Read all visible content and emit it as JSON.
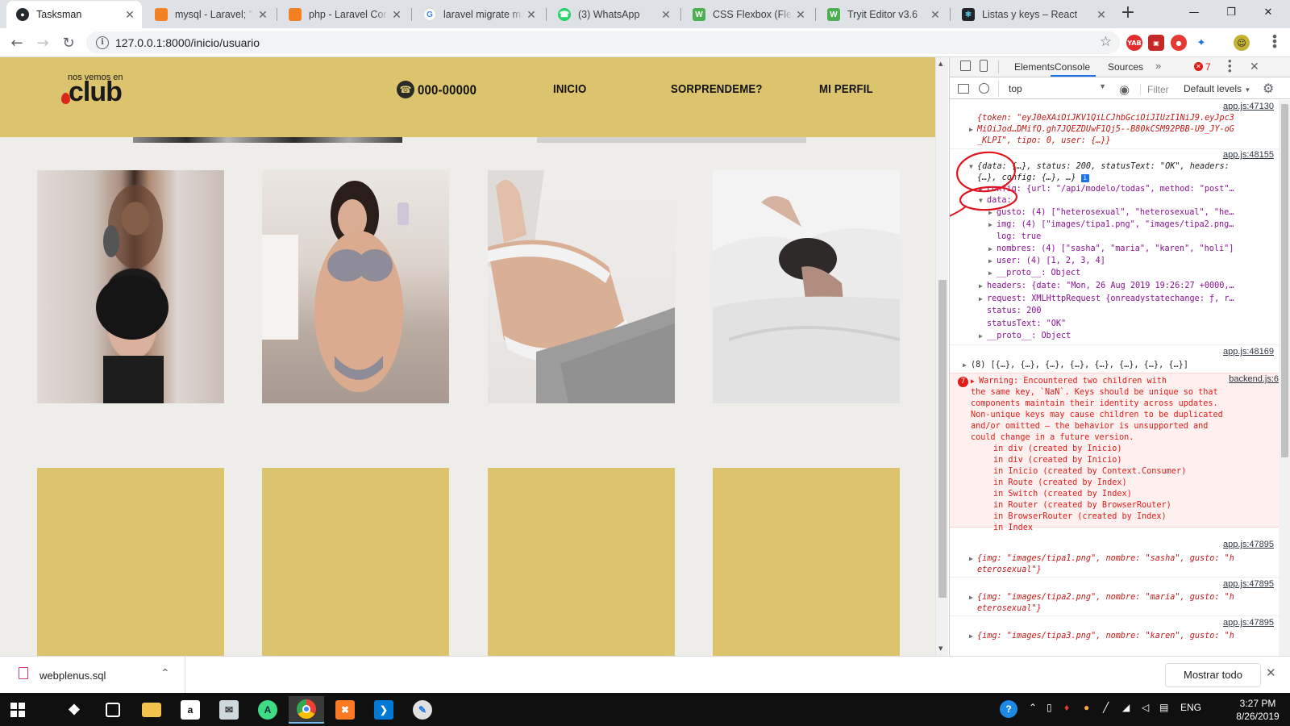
{
  "browser": {
    "tabs": [
      {
        "title": "Tasksman",
        "icon": "github-icon",
        "active": true
      },
      {
        "title": "mysql - Laravel; \"SQ",
        "icon": "stackoverflow-icon",
        "active": false
      },
      {
        "title": "php - Laravel Conne",
        "icon": "stackoverflow-icon",
        "active": false
      },
      {
        "title": "laravel migrate mac",
        "icon": "google-icon",
        "active": false
      },
      {
        "title": "(3) WhatsApp",
        "icon": "whatsapp-icon",
        "active": false
      },
      {
        "title": "CSS Flexbox (Flexibl",
        "icon": "w3schools-icon",
        "active": false
      },
      {
        "title": "Tryit Editor v3.6",
        "icon": "w3schools-icon",
        "active": false
      },
      {
        "title": "Listas y keys – React",
        "icon": "react-icon",
        "active": false
      }
    ],
    "url": "127.0.0.1:8000/inicio/usuario",
    "extensions": [
      "YAB",
      "",
      "",
      "",
      ""
    ]
  },
  "site": {
    "logo_small": "nos vemos en",
    "logo_big": "club",
    "phone": "000-00000",
    "nav": [
      "INICIO",
      "SORPRENDEME?",
      "MI PERFIL"
    ],
    "photos": [
      {
        "name": "photo-1",
        "tone": "#b7a79d"
      },
      {
        "name": "photo-2",
        "tone": "#c9b9ae"
      },
      {
        "name": "photo-3",
        "tone": "#e8e5e2"
      },
      {
        "name": "photo-4",
        "tone": "#e9e8e8"
      }
    ],
    "colors": {
      "header": "#dcc46e",
      "background": "#efedea"
    }
  },
  "devtools": {
    "tabs": [
      "Elements",
      "Console",
      "Sources"
    ],
    "active_tab": "Console",
    "error_count": "7",
    "context": "top",
    "filter_placeholder": "Filter",
    "levels": "Default levels",
    "sources": {
      "s1": "app.js:47130",
      "s2": "app.js:48155",
      "s3": "app.js:48169",
      "s4": "backend.js:6",
      "s5": "app.js:47895",
      "s6": "app.js:47895",
      "s7": "app.js:47895"
    },
    "log": {
      "l1": "{token: \"eyJ0eXAiOiJKV1QiLCJhbGciOiJIUzI1NiJ9.eyJpc3",
      "l2": "MiOiJod…DMifQ.gh7JQEZDUwF1Qj5--B80kCSM92PBB-U9_JY-oG",
      "l3": "_KLPI\", tipo: 0, user: {…}}",
      "m1": "{data: {…}, status: 200, statusText: \"OK\", headers:",
      "m2": "{…}, config: {…}, …}",
      "m3": "config: {url: \"/api/modelo/todas\", method: \"post\"…",
      "m4": "data:",
      "m5": "gusto: (4) [\"heterosexual\", \"heterosexual\", \"he…",
      "m6": "img: (4) [\"images/tipa1.png\", \"images/tipa2.png…",
      "m7": "log: true",
      "m8": "nombres: (4) [\"sasha\", \"maria\", \"karen\", \"holi\"]",
      "m9": "user: (4) [1, 2, 3, 4]",
      "m10": "__proto__: Object",
      "m11": "headers: {date: \"Mon, 26 Aug 2019 19:26:27 +0000,…",
      "m12": "request: XMLHttpRequest {onreadystatechange: ƒ, r…",
      "m13": "status: 200",
      "m14": "statusText: \"OK\"",
      "m15": "__proto__: Object",
      "a1": "(8) [{…}, {…}, {…}, {…}, {…}, {…}, {…}, {…}]",
      "w1": "Warning: Encountered two children with",
      "w2": "the same key, `NaN`. Keys should be unique so that",
      "w3": "components maintain their identity across updates.",
      "w4": "Non-unique keys may cause children to be duplicated",
      "w5": "and/or omitted — the behavior is unsupported and",
      "w6": "could change in a future version.",
      "w7": "in div (created by Inicio)",
      "w8": "in div (created by Inicio)",
      "w9": "in Inicio (created by Context.Consumer)",
      "w10": "in Route (created by Index)",
      "w11": "in Switch (created by Index)",
      "w12": "in Router (created by BrowserRouter)",
      "w13": "in BrowserRouter (created by Index)",
      "w14": "in Index",
      "o1a": "{img: \"images/tipa1.png\", nombre: \"sasha\", gusto: \"h",
      "o1b": "eterosexual\"}",
      "o2a": "{img: \"images/tipa2.png\", nombre: \"maria\", gusto: \"h",
      "o2b": "eterosexual\"}",
      "o3a": "{img: \"images/tipa3.png\", nombre: \"karen\", gusto: \"h"
    },
    "annotation_color": "#e0141e"
  },
  "download": {
    "filename": "webplenus.sql",
    "show_all": "Mostrar todo"
  },
  "taskbar": {
    "apps": [
      "start-icon",
      "dropbox-icon",
      "store-icon",
      "explorer-icon",
      "amazon-icon",
      "mail-icon",
      "android-studio-icon",
      "chrome-icon",
      "xampp-icon",
      "vscode-icon",
      "paint-icon"
    ],
    "lang": "ENG",
    "time": "3:27 PM",
    "date": "8/26/2019"
  }
}
